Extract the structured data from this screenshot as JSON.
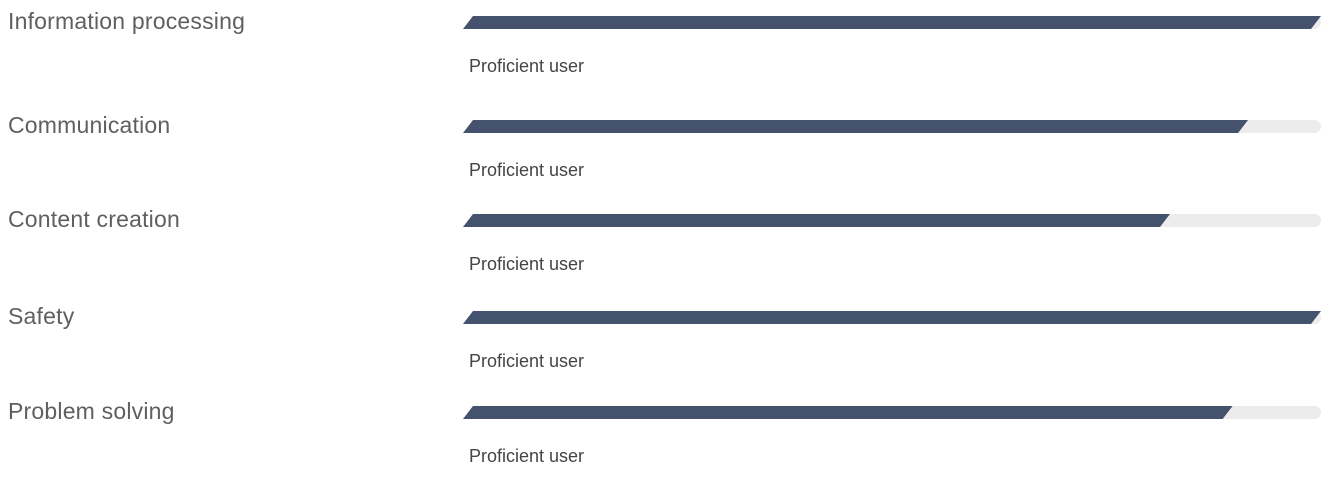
{
  "skills": [
    {
      "name": "Information processing",
      "level_label": "Proficient user",
      "level": 1.0
    },
    {
      "name": "Communication",
      "level_label": "Proficient user",
      "level": 0.915
    },
    {
      "name": "Content creation",
      "level_label": "Proficient user",
      "level": 0.824
    },
    {
      "name": "Safety",
      "level_label": "Proficient user",
      "level": 1.0
    },
    {
      "name": "Problem solving",
      "level_label": "Proficient user",
      "level": 0.897
    }
  ],
  "colors": {
    "fill": "#44526e",
    "track": "#ececec",
    "name_text": "#5f5f5f",
    "level_text": "#444444"
  }
}
